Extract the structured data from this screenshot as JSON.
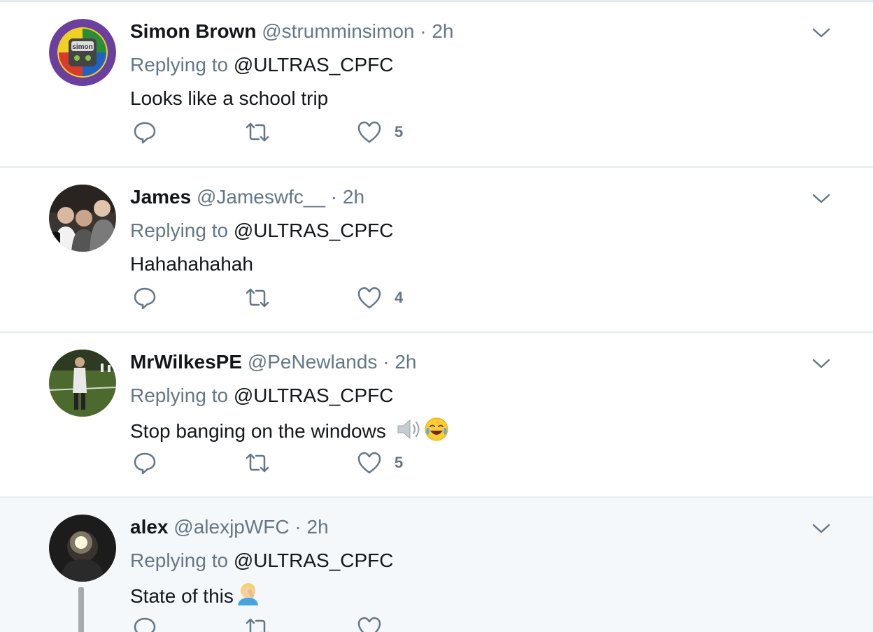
{
  "tweets": [
    {
      "name": "Simon Brown",
      "handle": "@strumminsimon",
      "time": "2h",
      "replying_label": "Replying to",
      "replying_to": "@ULTRAS_CPFC",
      "text": "Looks like a school trip",
      "emoji": [],
      "reply_count": "",
      "retweet_count": "",
      "like_count": "5",
      "avatar_icon": "simon-badge-avatar",
      "avatar_text": "simon"
    },
    {
      "name": "James",
      "handle": "@Jameswfc__",
      "time": "2h",
      "replying_label": "Replying to",
      "replying_to": "@ULTRAS_CPFC",
      "text": "Hahahahahah",
      "emoji": [],
      "reply_count": "",
      "retweet_count": "",
      "like_count": "4",
      "avatar_icon": "group-photo-avatar"
    },
    {
      "name": "MrWilkesPE",
      "handle": "@PeNewlands",
      "time": "2h",
      "replying_label": "Replying to",
      "replying_to": "@ULTRAS_CPFC",
      "text": "Stop banging on the windows",
      "emoji": [
        "speaker-loud-icon",
        "tears-of-joy-icon"
      ],
      "reply_count": "",
      "retweet_count": "",
      "like_count": "5",
      "avatar_icon": "football-pitch-avatar"
    },
    {
      "name": "alex",
      "handle": "@alexjpWFC",
      "time": "2h",
      "replying_label": "Replying to",
      "replying_to": "@ULTRAS_CPFC",
      "text": "State of this",
      "emoji": [
        "facepalm-icon"
      ],
      "reply_count": "",
      "retweet_count": "",
      "like_count": "",
      "avatar_icon": "dark-selfie-avatar",
      "highlighted": true
    }
  ],
  "separator_dot": "·",
  "colors": {
    "text_primary": "#14171a",
    "text_secondary": "#657786",
    "divider": "#e6ecf0",
    "highlight_bg": "#f5f8fa",
    "thread_line": "#a7aaad"
  }
}
